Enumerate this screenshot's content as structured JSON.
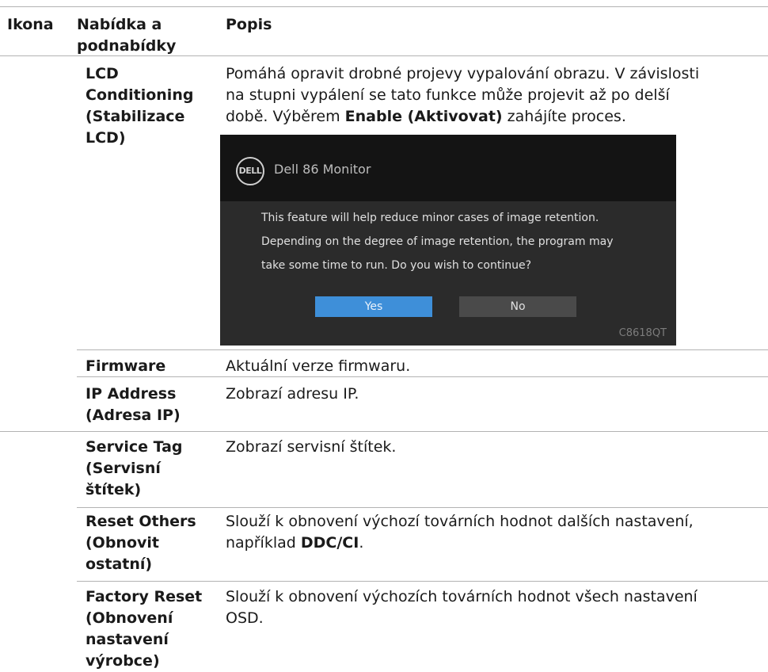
{
  "headers": {
    "icon": "Ikona",
    "menu_1": "Nabídka a",
    "menu_2": "podnabídky",
    "desc": "Popis"
  },
  "rows": [
    {
      "menu": [
        "LCD",
        "Conditioning",
        "(Stabilizace",
        "LCD)"
      ],
      "desc_1": "Pomáhá opravit drobné projevy vypalování obrazu. V závislosti",
      "desc_2": "na stupni vypálení se tato funkce může projevit až po delší",
      "desc_3_pre": "době. Výběrem ",
      "desc_3_bold": "Enable (Aktivovat)",
      "desc_3_post": " zahájíte proces."
    },
    {
      "menu": [
        "Firmware"
      ],
      "desc_1": "Aktuální verze firmwaru."
    },
    {
      "menu": [
        "IP Address",
        "(Adresa IP)"
      ],
      "desc_1": "Zobrazí adresu IP."
    },
    {
      "menu": [
        "Service Tag",
        "(Servisní",
        "štítek)"
      ],
      "desc_1": "Zobrazí servisní štítek."
    },
    {
      "menu": [
        "Reset Others",
        "(Obnovit",
        "ostatní)"
      ],
      "desc_1": "Slouží k obnovení výchozí továrních hodnot dalších nastavení,",
      "desc_2_pre": "například ",
      "desc_2_bold": "DDC/CI",
      "desc_2_post": "."
    },
    {
      "menu": [
        "Factory Reset",
        "(Obnovení",
        "nastavení",
        "výrobce)"
      ],
      "desc_1": "Slouží k obnovení výchozích továrních hodnot všech nastavení",
      "desc_2": "OSD."
    }
  ],
  "osd": {
    "logo": "DELL",
    "title": "Dell 86 Monitor",
    "message": [
      "This feature will help reduce minor cases of image retention.",
      "Depending on the degree of image retention, the program may",
      "take some time to run. Do you wish to continue?"
    ],
    "yes": "Yes",
    "no": "No",
    "model": "C8618QT",
    "colors": {
      "title_bg": "#141414",
      "body_bg": "#2b2b2b",
      "yes_bg": "#3e8fd9",
      "no_bg": "#4a4a4a"
    }
  }
}
